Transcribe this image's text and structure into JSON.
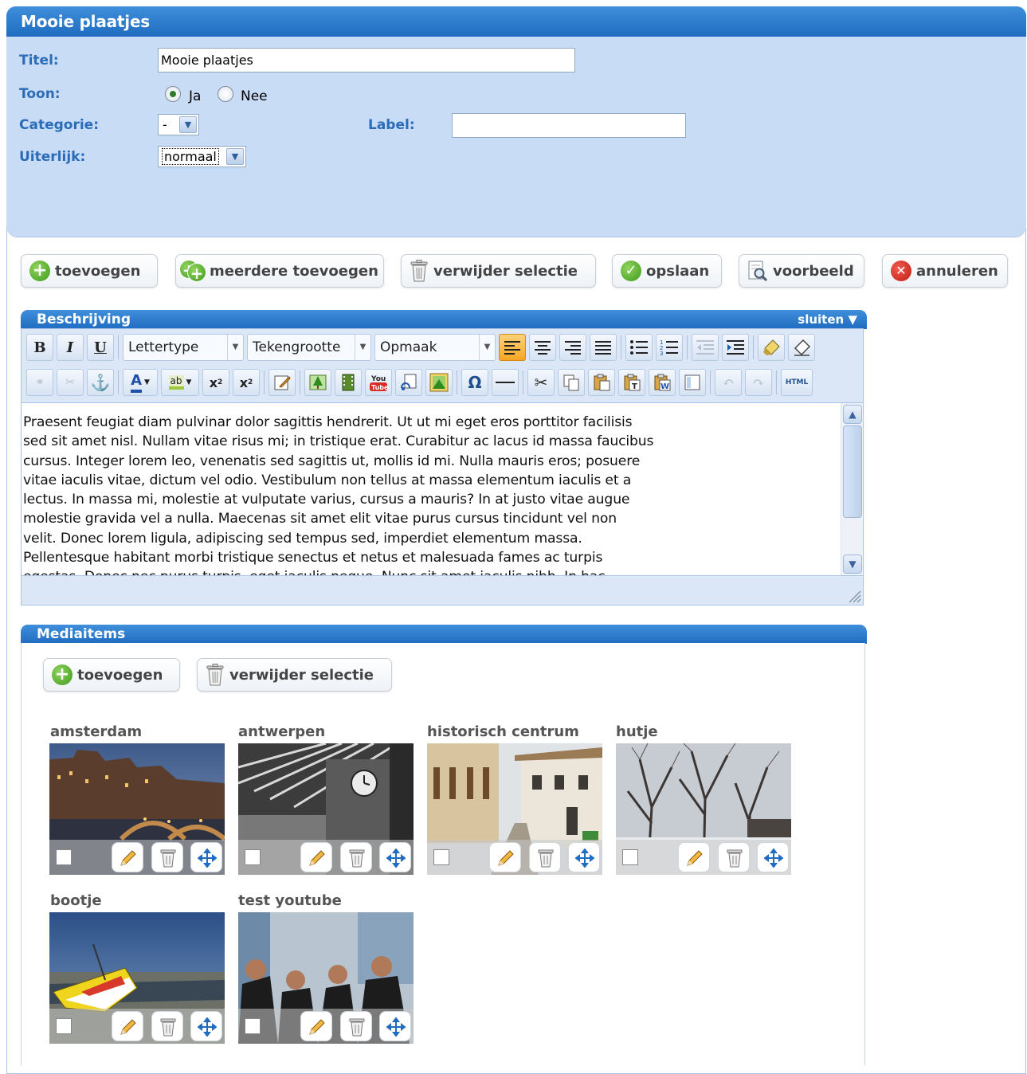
{
  "window": {
    "title": "Mooie plaatjes"
  },
  "form": {
    "titel_label": "Titel:",
    "titel_value": "Mooie plaatjes",
    "toon_label": "Toon:",
    "toon_options": [
      "Ja",
      "Nee"
    ],
    "toon_selected": "Ja",
    "categorie_label": "Categorie:",
    "categorie_value": "-",
    "label_label": "Label:",
    "label_value": "",
    "uiterlijk_label": "Uiterlijk:",
    "uiterlijk_value": "normaal"
  },
  "toolbar": {
    "add": "toevoegen",
    "add_multiple": "meerdere toevoegen",
    "delete_selection": "verwijder selectie",
    "save": "opslaan",
    "preview": "voorbeeld",
    "cancel": "annuleren"
  },
  "description": {
    "header": "Beschrijving",
    "close": "sluiten",
    "font_select": "Lettertype",
    "size_select": "Tekengrootte",
    "format_select": "Opmaak",
    "text_lines": [
      "Praesent feugiat diam pulvinar dolor sagittis hendrerit. Ut ut mi eget eros porttitor facilisis",
      "sed sit amet nisl. Nullam vitae risus mi; in tristique erat. Curabitur ac lacus id massa faucibus",
      "cursus. Integer lorem leo, venenatis sed sagittis ut, mollis id mi. Nulla mauris eros; posuere",
      "vitae iaculis vitae, dictum vel odio. Vestibulum non tellus at massa elementum iaculis et a",
      "lectus. In massa mi, molestie at vulputate varius, cursus a mauris? In at justo vitae augue",
      "molestie gravida vel a nulla. Maecenas sit amet elit vitae purus cursus tincidunt vel non",
      "velit. Donec lorem ligula, adipiscing sed tempus sed, imperdiet elementum massa.",
      "Pellentesque habitant morbi tristique senectus et netus et malesuada fames ac turpis",
      "egestas. Donec nec purus turpis, eget iaculis neque. Nunc sit amet iaculis nibh. In hac"
    ]
  },
  "media": {
    "header": "Mediaitems",
    "add": "toevoegen",
    "delete_selection": "verwijder selectie",
    "items": [
      {
        "title": "amsterdam"
      },
      {
        "title": "antwerpen"
      },
      {
        "title": "historisch centrum"
      },
      {
        "title": "hutje"
      },
      {
        "title": "bootje"
      },
      {
        "title": "test youtube"
      }
    ]
  },
  "icons": {
    "add": "plus-circle-icon",
    "delete": "trash-icon",
    "save": "checkmark-icon",
    "preview": "magnifier-document-icon",
    "cancel": "x-circle-icon",
    "edit": "pencil-icon",
    "move": "move-arrows-icon"
  },
  "colors": {
    "header_blue": "#2a7ccd",
    "form_bg": "#c8dcf6",
    "label_blue": "#2b6cb8"
  }
}
